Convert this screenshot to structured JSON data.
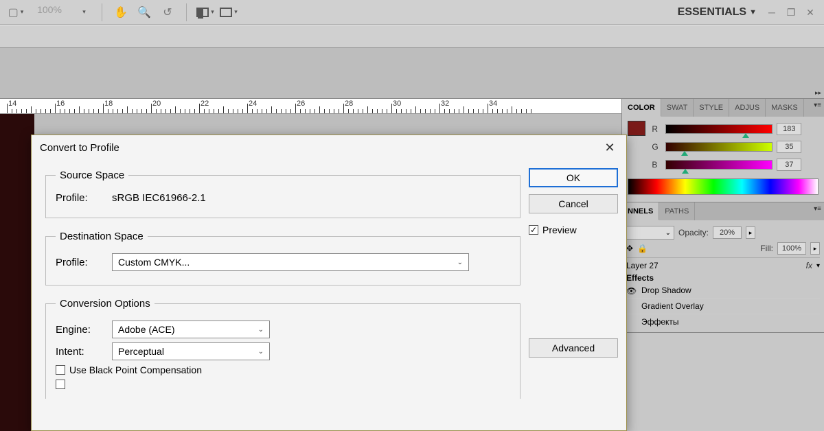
{
  "toolbar": {
    "zoom": "100%"
  },
  "workspace": {
    "label": "ESSENTIALS"
  },
  "ruler": {
    "marks": [
      "14",
      "16",
      "18",
      "20",
      "22",
      "24",
      "26",
      "28",
      "30",
      "32",
      "34"
    ]
  },
  "panels": {
    "color": {
      "tabs": [
        "COLOR",
        "SWAT",
        "STYLE",
        "ADJUS",
        "MASKS"
      ],
      "channels": [
        {
          "label": "R",
          "value": "183",
          "class": "r",
          "pos": 72
        },
        {
          "label": "G",
          "value": "35",
          "class": "g",
          "pos": 14
        },
        {
          "label": "B",
          "value": "37",
          "class": "b",
          "pos": 15
        }
      ]
    },
    "layers": {
      "tabs": [
        "NNELS",
        "PATHS"
      ],
      "opacity_label": "Opacity:",
      "opacity_value": "20%",
      "fill_label": "Fill:",
      "fill_value": "100%",
      "layer_name": "Layer 27",
      "fx": "fx",
      "effects_label": "Effects",
      "effect1": "Drop Shadow",
      "effect2": "Gradient Overlay",
      "effect3": "Эффекты"
    }
  },
  "dialog": {
    "title": "Convert to Profile",
    "source_legend": "Source Space",
    "profile_label": "Profile:",
    "source_profile": "sRGB IEC61966-2.1",
    "dest_legend": "Destination Space",
    "dest_profile": "Custom CMYK...",
    "conv_legend": "Conversion Options",
    "engine_label": "Engine:",
    "engine_value": "Adobe (ACE)",
    "intent_label": "Intent:",
    "intent_value": "Perceptual",
    "black_point": "Use Black Point Compensation",
    "ok": "OK",
    "cancel": "Cancel",
    "preview": "Preview",
    "advanced": "Advanced"
  }
}
